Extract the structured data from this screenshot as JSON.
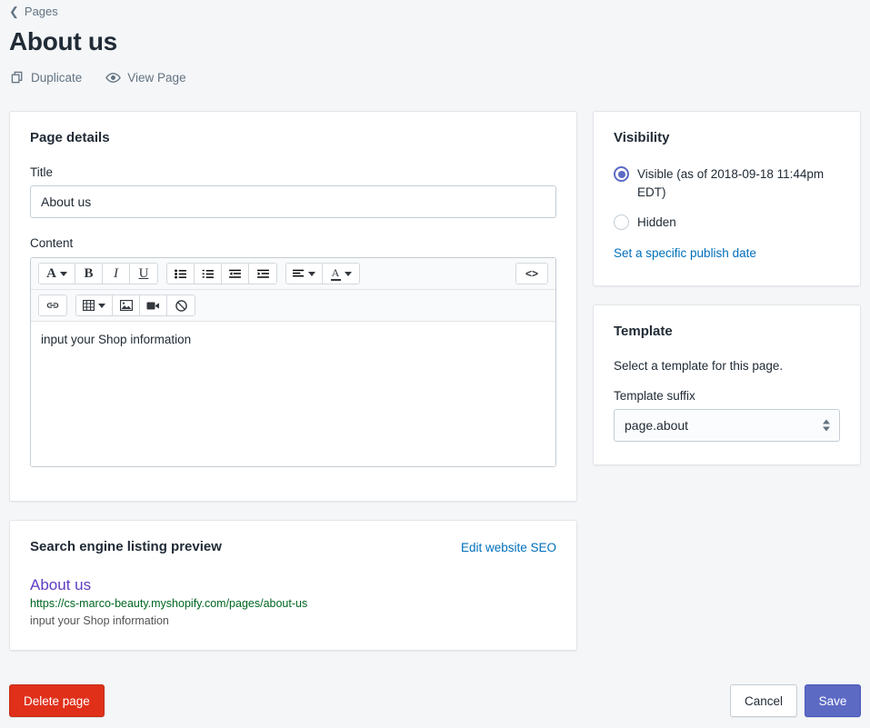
{
  "header": {
    "breadcrumb": "Pages",
    "back_icon": "chevron-left-icon",
    "title": "About us",
    "actions": [
      {
        "label": "Duplicate",
        "icon": "duplicate-icon"
      },
      {
        "label": "View Page",
        "icon": "eye-icon"
      }
    ]
  },
  "page_details": {
    "card_title": "Page details",
    "title_label": "Title",
    "title_value": "About us",
    "title_placeholder": "",
    "content_label": "Content",
    "content_value": "input your Shop information",
    "toolbar": {
      "row1": [
        {
          "name": "format-style-dropdown",
          "glyph": "A",
          "caret": true
        },
        {
          "name": "bold-button",
          "glyph": "B"
        },
        {
          "name": "italic-button",
          "glyph": "I"
        },
        {
          "name": "underline-button",
          "glyph": "U"
        },
        {
          "name": "bulleted-list-button",
          "glyph": "☰"
        },
        {
          "name": "numbered-list-button",
          "glyph": "☷"
        },
        {
          "name": "outdent-button",
          "glyph": "⇤"
        },
        {
          "name": "indent-button",
          "glyph": "⇥"
        },
        {
          "name": "align-dropdown",
          "glyph": "≡",
          "caret": true
        },
        {
          "name": "text-color-dropdown",
          "glyph": "A",
          "caret": true
        }
      ],
      "code_button": "<>",
      "row2": [
        {
          "name": "insert-link-button",
          "glyph": "⚭"
        },
        {
          "name": "insert-table-dropdown",
          "glyph": "▦",
          "caret": true
        },
        {
          "name": "insert-image-button",
          "glyph": "▣"
        },
        {
          "name": "insert-video-button",
          "glyph": "▶"
        },
        {
          "name": "clear-formatting-button",
          "glyph": "⊘"
        }
      ]
    }
  },
  "visibility": {
    "card_title": "Visibility",
    "options": [
      {
        "label": "Visible (as of 2018-09-18 11:44pm EDT)",
        "selected": true
      },
      {
        "label": "Hidden",
        "selected": false
      }
    ],
    "publish_date_link": "Set a specific publish date"
  },
  "template": {
    "card_title": "Template",
    "description": "Select a template for this page.",
    "suffix_label": "Template suffix",
    "suffix_value": "page.about"
  },
  "seo": {
    "card_title": "Search engine listing preview",
    "edit_link": "Edit website SEO",
    "result_title": "About us",
    "result_url": "https://cs-marco-beauty.myshopify.com/pages/about-us",
    "result_description": "input your Shop information"
  },
  "footer": {
    "delete_label": "Delete page",
    "cancel_label": "Cancel",
    "save_label": "Save"
  },
  "colors": {
    "accent": "#5c6ac4",
    "destructive": "#e0301a",
    "link": "#006fbb",
    "seo_title": "#5f3dc4",
    "seo_url": "#006621",
    "background": "#f4f6f8"
  }
}
